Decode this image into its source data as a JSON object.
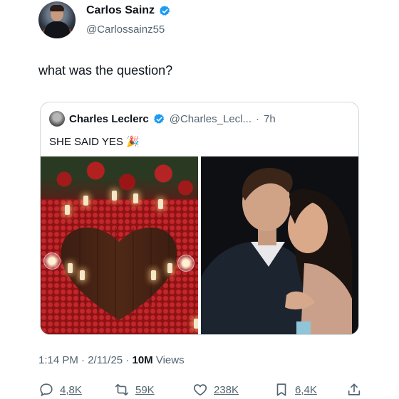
{
  "author": {
    "display_name": "Carlos Sainz",
    "handle": "@Carlossainz55",
    "verified": true
  },
  "tweet": {
    "text": "what was the question?"
  },
  "quoted_tweet": {
    "display_name": "Charles Leclerc",
    "handle": "@Charles_Lecl...",
    "separator": "·",
    "time": "7h",
    "verified": true,
    "text": "SHE SAID YES",
    "emoji": "🎉",
    "media_icons": [
      "rose-heart-photo",
      "couple-engagement-photo"
    ]
  },
  "meta": {
    "time": "1:14 PM",
    "separator": "·",
    "date": "2/11/25",
    "separator2": "·",
    "views": "10M",
    "views_label": "Views"
  },
  "actions": {
    "replies": "4,8K",
    "reposts": "59K",
    "likes": "238K",
    "bookmarks": "6,4K"
  },
  "colors": {
    "verified_blue": "#1d9bf0",
    "secondary_text": "#536471",
    "border": "#cfd9de"
  }
}
